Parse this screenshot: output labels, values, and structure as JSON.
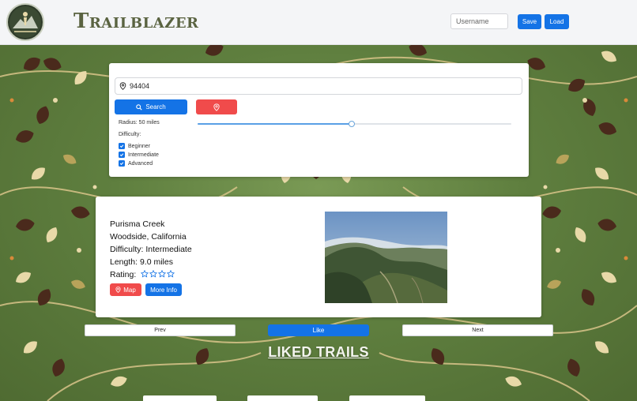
{
  "header": {
    "brand": "Trailblazer",
    "username_placeholder": "Username",
    "save_label": "Save",
    "load_label": "Load",
    "logo_icon": "hiker-badge-icon"
  },
  "search": {
    "zip_value": "94404",
    "search_label": "Search",
    "radius_text": "Radius: 50 miles",
    "radius_fraction": 0.49,
    "difficulty_label": "Difficulty:",
    "difficulties": [
      {
        "label": "Beginner",
        "checked": true
      },
      {
        "label": "Intermediate",
        "checked": true
      },
      {
        "label": "Advanced",
        "checked": true
      }
    ]
  },
  "trail": {
    "name": "Purisma Creek",
    "location": "Woodside, California",
    "difficulty": "Difficulty: Intermediate",
    "length": "Length: 9.0 miles",
    "rating_label": "Rating:",
    "rating_stars": 0,
    "rating_max": 4,
    "map_label": "Map",
    "more_info_label": "More Info"
  },
  "nav": {
    "prev_label": "Prev",
    "like_label": "Like",
    "next_label": "Next"
  },
  "liked": {
    "title": "LIKED TRAILS"
  },
  "colors": {
    "primary": "#1473e6",
    "danger": "#f04b4b",
    "brand": "#5a6341",
    "background_green": "#5f7f3f"
  }
}
